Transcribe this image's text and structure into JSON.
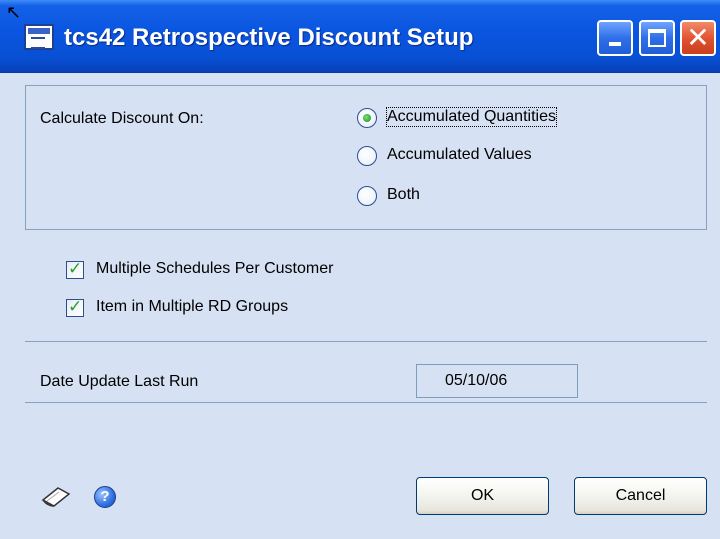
{
  "window": {
    "title": "tcs42 Retrospective Discount Setup",
    "titlebar_color": "#0a55e0",
    "background_color": "#d6e1f3"
  },
  "calc": {
    "label": "Calculate Discount On:",
    "options": [
      {
        "label": "Accumulated Quantities",
        "checked": true
      },
      {
        "label": "Accumulated Values",
        "checked": false
      },
      {
        "label": "Both",
        "checked": false
      }
    ]
  },
  "checks": [
    {
      "label": "Multiple Schedules Per Customer",
      "checked": true
    },
    {
      "label": "Item in Multiple RD Groups",
      "checked": true
    }
  ],
  "last_run": {
    "label": "Date Update Last Run",
    "value": "05/10/06"
  },
  "footer": {
    "note_icon": "note-icon",
    "help_icon": "help-icon",
    "ok_label": "OK",
    "cancel_label": "Cancel"
  }
}
